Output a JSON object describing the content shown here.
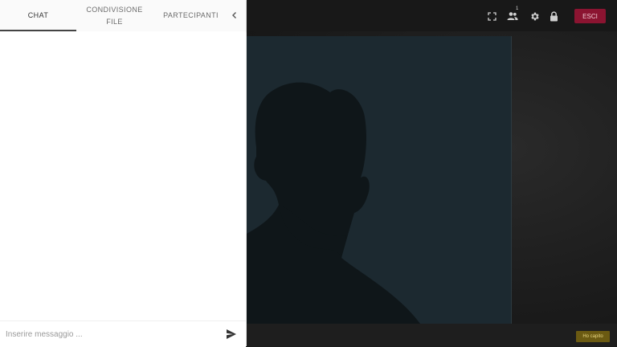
{
  "sidebar": {
    "tabs": [
      {
        "label": "CHAT",
        "active": true
      },
      {
        "label_line1": "CONDIVISIONE",
        "label_line2": "FILE",
        "active": false
      },
      {
        "label": "PARTECIPANTI",
        "active": false
      }
    ],
    "collapse_icon": "chevron-left-icon",
    "composer": {
      "placeholder": "Inserire messaggio ...",
      "value": "",
      "send_icon": "send-icon"
    }
  },
  "toolbar": {
    "icons": [
      "fullscreen-icon",
      "participants-icon",
      "settings-icon",
      "lock-icon"
    ],
    "participants_count": "1",
    "leave_label": "ESCI",
    "leave_color": "#8b1431"
  },
  "stage": {
    "placeholder_avatar": "person-silhouette",
    "background_color": "#1c2930"
  },
  "notice": {
    "button_label": "Ho capito",
    "button_color": "#6b5a12"
  }
}
